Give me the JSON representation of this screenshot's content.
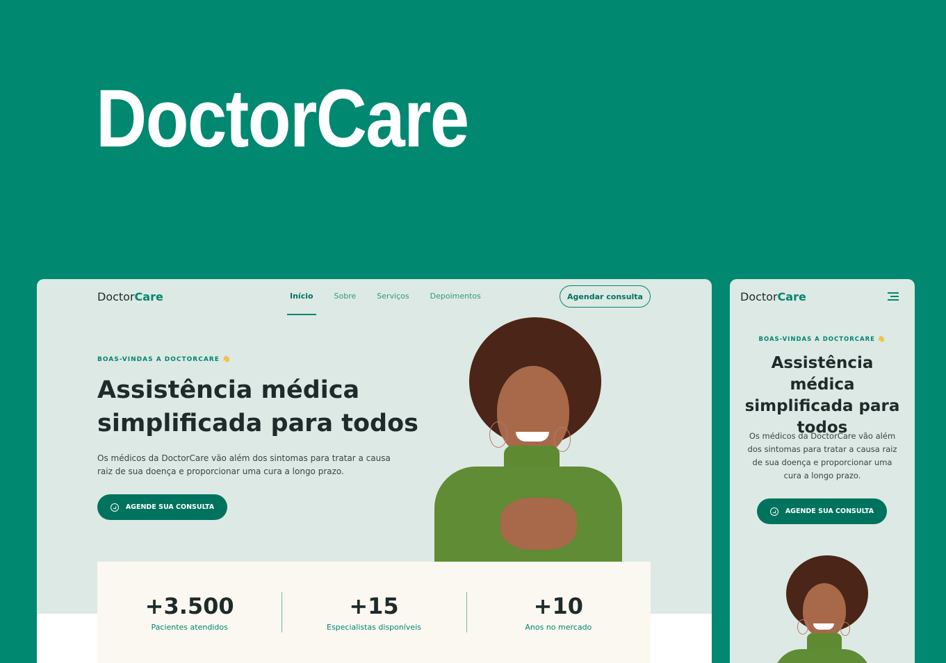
{
  "hero_title": "DoctorCare",
  "brand": {
    "logo_part1": "Doctor",
    "logo_part2": "Care"
  },
  "nav": {
    "items": [
      "Início",
      "Sobre",
      "Serviços",
      "Depoimentos"
    ],
    "active": "Início",
    "cta_label": "Agendar consulta"
  },
  "hero": {
    "eyebrow": "BOAS-VINDAS A DOCTORCARE 👋",
    "headline": "Assistência médica simplificada para todos",
    "lead": "Os médicos da DoctorCare vão além dos sintomas para tratar a causa raiz de sua doença e proporcionar uma cura a longo prazo.",
    "button_label": "AGENDE SUA CONSULTA",
    "button_icon": "whatsapp-icon"
  },
  "stats": [
    {
      "value": "+3.500",
      "label": "Pacientes atendidos"
    },
    {
      "value": "+15",
      "label": "Especialistas disponíveis"
    },
    {
      "value": "+10",
      "label": "Anos no mercado"
    }
  ],
  "colors": {
    "background": "#008870",
    "accent": "#00856f",
    "mockup_bg": "#dde9e4",
    "stats_bg": "#fbf8f1",
    "text": "#1f2a2a"
  }
}
